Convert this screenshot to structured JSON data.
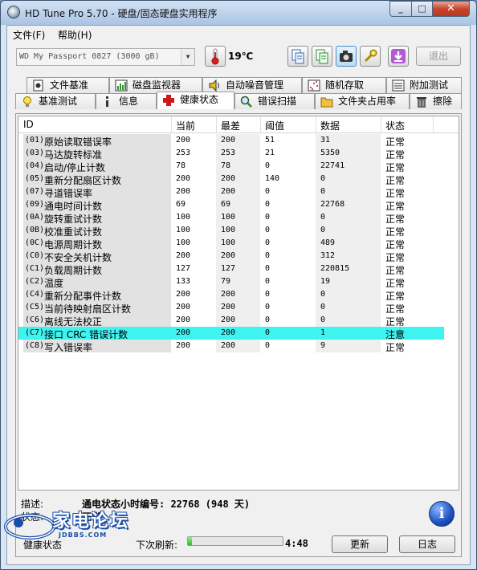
{
  "window": {
    "title": "HD Tune Pro 5.70 - 硬盘/固态硬盘实用程序"
  },
  "menu": [
    {
      "label": "文件(F)"
    },
    {
      "label": "帮助(H)"
    }
  ],
  "toolbar": {
    "drive": "WD      My Passport 0827  (3000 gB)",
    "temperature": "19℃",
    "exit_label": "退出"
  },
  "tabs_top": [
    {
      "label": "文件基准",
      "icon": "file-benchmark-icon"
    },
    {
      "label": "磁盘监视器",
      "icon": "disk-monitor-icon"
    },
    {
      "label": "自动噪音管理",
      "icon": "speaker-icon"
    },
    {
      "label": "随机存取",
      "icon": "random-access-icon"
    },
    {
      "label": "附加测试",
      "icon": "extra-tests-icon"
    }
  ],
  "tabs_bottom": [
    {
      "label": "基准测试",
      "icon": "lightbulb-icon"
    },
    {
      "label": "信息",
      "icon": "info-icon"
    },
    {
      "label": "健康状态",
      "icon": "red-cross-icon",
      "active": true
    },
    {
      "label": "错误扫描",
      "icon": "magnifier-icon"
    },
    {
      "label": "文件夹占用率",
      "icon": "folder-icon"
    },
    {
      "label": "擦除",
      "icon": "trash-icon"
    }
  ],
  "table": {
    "headers": [
      "ID",
      "当前",
      "最差",
      "阈值",
      "数据",
      "状态"
    ],
    "rows": [
      {
        "code": "(01)",
        "name": "原始读取错误率",
        "current": "200",
        "worst": "200",
        "threshold": "51",
        "data": "31",
        "status": "正常"
      },
      {
        "code": "(03)",
        "name": "马达旋转标准",
        "current": "253",
        "worst": "253",
        "threshold": "21",
        "data": "5350",
        "status": "正常"
      },
      {
        "code": "(04)",
        "name": "启动/停止计数",
        "current": "78",
        "worst": "78",
        "threshold": "0",
        "data": "22741",
        "status": "正常"
      },
      {
        "code": "(05)",
        "name": "重新分配扇区计数",
        "current": "200",
        "worst": "200",
        "threshold": "140",
        "data": "0",
        "status": "正常"
      },
      {
        "code": "(07)",
        "name": "寻道错误率",
        "current": "200",
        "worst": "200",
        "threshold": "0",
        "data": "0",
        "status": "正常"
      },
      {
        "code": "(09)",
        "name": "通电时间计数",
        "current": "69",
        "worst": "69",
        "threshold": "0",
        "data": "22768",
        "status": "正常"
      },
      {
        "code": "(0A)",
        "name": "旋转重试计数",
        "current": "100",
        "worst": "100",
        "threshold": "0",
        "data": "0",
        "status": "正常"
      },
      {
        "code": "(0B)",
        "name": "校准重试计数",
        "current": "100",
        "worst": "100",
        "threshold": "0",
        "data": "0",
        "status": "正常"
      },
      {
        "code": "(0C)",
        "name": "电源周期计数",
        "current": "100",
        "worst": "100",
        "threshold": "0",
        "data": "489",
        "status": "正常"
      },
      {
        "code": "(C0)",
        "name": "不安全关机计数",
        "current": "200",
        "worst": "200",
        "threshold": "0",
        "data": "312",
        "status": "正常"
      },
      {
        "code": "(C1)",
        "name": "负载周期计数",
        "current": "127",
        "worst": "127",
        "threshold": "0",
        "data": "220815",
        "status": "正常"
      },
      {
        "code": "(C2)",
        "name": "温度",
        "current": "133",
        "worst": "79",
        "threshold": "0",
        "data": "19",
        "status": "正常"
      },
      {
        "code": "(C4)",
        "name": "重新分配事件计数",
        "current": "200",
        "worst": "200",
        "threshold": "0",
        "data": "0",
        "status": "正常"
      },
      {
        "code": "(C5)",
        "name": "当前待映射扇区计数",
        "current": "200",
        "worst": "200",
        "threshold": "0",
        "data": "0",
        "status": "正常"
      },
      {
        "code": "(C6)",
        "name": "离线无法校正",
        "current": "200",
        "worst": "200",
        "threshold": "0",
        "data": "0",
        "status": "正常"
      },
      {
        "code": "(C7)",
        "name": "接口 CRC 错误计数",
        "current": "200",
        "worst": "200",
        "threshold": "0",
        "data": "1",
        "status": "注意",
        "selected": true
      },
      {
        "code": "(C8)",
        "name": "写入错误率",
        "current": "200",
        "worst": "200",
        "threshold": "0",
        "data": "9",
        "status": "正常"
      }
    ]
  },
  "details": {
    "desc_label": "描述:",
    "desc_value": "通电状态小时编号: 22768 (948 天)",
    "status_label": "状态:",
    "status_value": "正常"
  },
  "bottom": {
    "health_label": "健康状态",
    "refresh_label": "下次刷新:",
    "progress": 0.04,
    "countdown": "4:48",
    "update_label": "更新",
    "log_label": "日志"
  },
  "watermark": {
    "text": "家电论坛",
    "sub": "JDBBS.COM"
  },
  "colors": {
    "selected_row": "#3ef3f0",
    "accent": "#1a4fa8"
  }
}
